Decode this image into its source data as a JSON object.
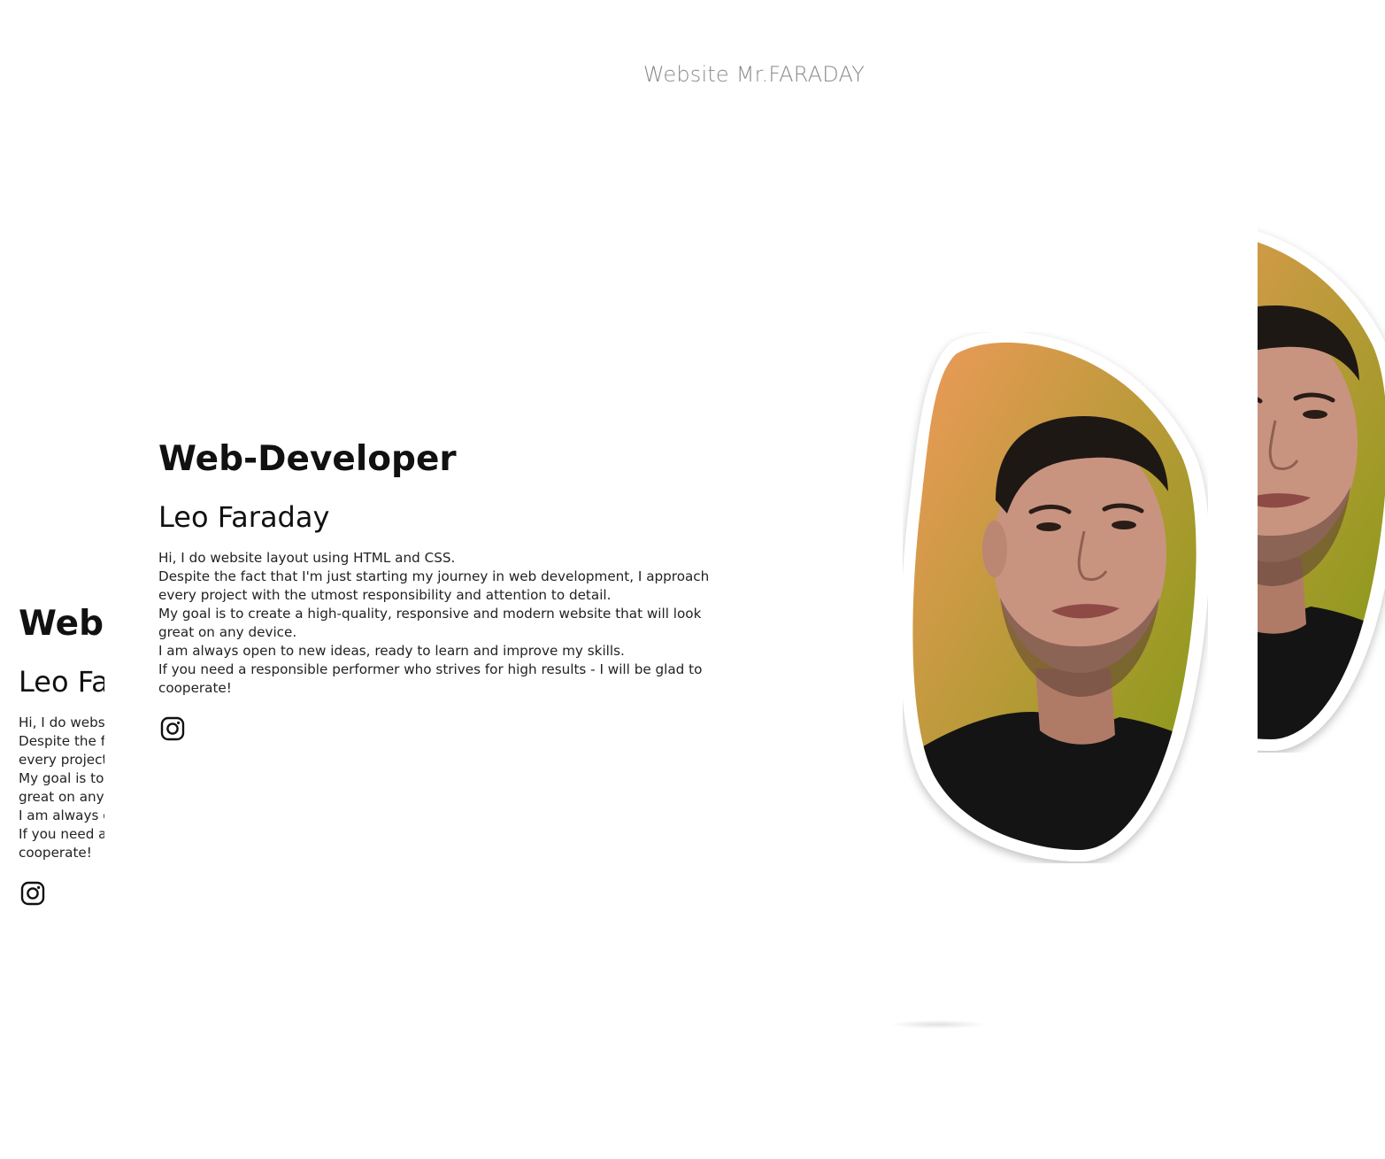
{
  "header": {
    "site_title": "Website Mr.FARADAY"
  },
  "hero": {
    "role": "Web-Developer",
    "name": "Leo Faraday",
    "bio": [
      "Hi, I do website layout using HTML and CSS.",
      "Despite the fact that I'm just starting my journey in web development, I approach every project with the utmost responsibility and attention to detail.",
      "My goal is to create a high-quality, responsive and modern website that will look great on any device.",
      "I am always open to new ideas, ready to learn and improve my skills.",
      "If you need a responsible performer who strives for high results - I will be glad to cooperate!"
    ],
    "social": {
      "icon": "instagram-icon"
    }
  },
  "photo": {
    "icon": "portrait-photo",
    "gradient": [
      "#f0a25c",
      "#7f9a14"
    ],
    "border": "#ffffff"
  }
}
